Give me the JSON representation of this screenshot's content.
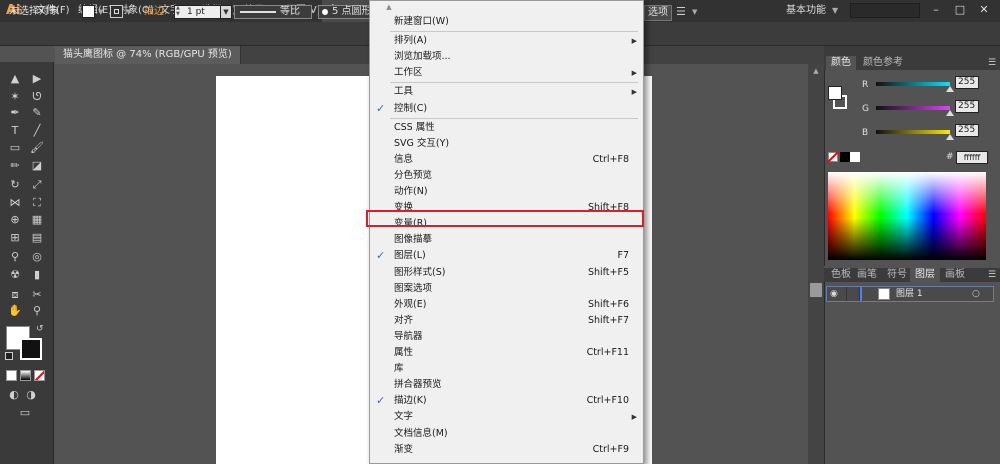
{
  "app": {
    "logo": "Ai"
  },
  "menubar": {
    "items": [
      "文件(F)",
      "编辑(E)",
      "对象(O)",
      "文字(T)",
      "选择(S)",
      "效果(C)",
      "视图(V)",
      "窗口(W)"
    ],
    "workspace": "基本功能",
    "window_controls": [
      "–",
      "□",
      "✕"
    ]
  },
  "controlbar": {
    "selection": "未选择对象",
    "stroke_label": "描边:",
    "stroke_value": "1 pt",
    "profile_label": "等比",
    "brush_label": "5 点圆形",
    "options_label": "选项"
  },
  "document": {
    "tab_title": "猫头鹰图标 @ 74% (RGB/GPU 预览)"
  },
  "color_panel": {
    "tabs": [
      "颜色",
      "颜色参考"
    ],
    "sliders": [
      {
        "label": "R",
        "value": "255",
        "color": "#00e5ff"
      },
      {
        "label": "G",
        "value": "255",
        "color": "#e040fb"
      },
      {
        "label": "B",
        "value": "255",
        "color": "#ffea00"
      }
    ],
    "hex_prefix": "#",
    "hex": "ffffff"
  },
  "layers_panel": {
    "tabs": [
      "色板",
      "画笔",
      "符号",
      "图层",
      "画板"
    ],
    "active_tab": "图层",
    "layers": [
      {
        "name": "图层 1"
      }
    ]
  },
  "window_menu": {
    "items": [
      {
        "label": "新建窗口(W)"
      },
      {
        "sep": true
      },
      {
        "label": "排列(A)",
        "submenu": true
      },
      {
        "label": "浏览加载项..."
      },
      {
        "label": "工作区",
        "submenu": true
      },
      {
        "sep": true
      },
      {
        "label": "工具",
        "submenu": true
      },
      {
        "label": "控制(C)",
        "checked": true
      },
      {
        "sep": true
      },
      {
        "label": "CSS 属性"
      },
      {
        "label": "SVG 交互(Y)"
      },
      {
        "label": "信息",
        "shortcut": "Ctrl+F8"
      },
      {
        "label": "分色预览"
      },
      {
        "label": "动作(N)"
      },
      {
        "label": "变换",
        "shortcut": "Shift+F8",
        "highlighted": true
      },
      {
        "label": "变量(R)"
      },
      {
        "label": "图像描摹"
      },
      {
        "label": "图层(L)",
        "shortcut": "F7",
        "checked": true
      },
      {
        "label": "图形样式(S)",
        "shortcut": "Shift+F5"
      },
      {
        "label": "图案选项"
      },
      {
        "label": "外观(E)",
        "shortcut": "Shift+F6"
      },
      {
        "label": "对齐",
        "shortcut": "Shift+F7"
      },
      {
        "label": "导航器"
      },
      {
        "label": "属性",
        "shortcut": "Ctrl+F11"
      },
      {
        "label": "库"
      },
      {
        "label": "拼合器预览"
      },
      {
        "label": "描边(K)",
        "shortcut": "Ctrl+F10",
        "checked": true
      },
      {
        "label": "文字",
        "submenu": true
      },
      {
        "label": "文档信息(M)"
      },
      {
        "label": "渐变",
        "shortcut": "Ctrl+F9"
      }
    ]
  },
  "toolbar": {
    "tools": [
      [
        "selection-tool",
        "▲"
      ],
      [
        "direct-selection-tool",
        "▶"
      ],
      [
        "magic-wand-tool",
        "✶"
      ],
      [
        "lasso-tool",
        "ᘎ"
      ],
      [
        "pen-tool",
        "✒"
      ],
      [
        "curvature-tool",
        "✎"
      ],
      [
        "type-tool",
        "T"
      ],
      [
        "line-tool",
        "╱"
      ],
      [
        "rectangle-tool",
        "▭"
      ],
      [
        "paintbrush-tool",
        "🖌"
      ],
      [
        "pencil-tool",
        "✏"
      ],
      [
        "eraser-tool",
        "◪"
      ],
      [
        "rotate-tool",
        "↻"
      ],
      [
        "scale-tool",
        "⤢"
      ],
      [
        "width-tool",
        "⋈"
      ],
      [
        "free-transform-tool",
        "⛶"
      ],
      [
        "shape-builder-tool",
        "⊕"
      ],
      [
        "perspective-tool",
        "▦"
      ],
      [
        "mesh-tool",
        "⊞"
      ],
      [
        "gradient-tool",
        "▤"
      ],
      [
        "eyedropper-tool",
        "⚲"
      ],
      [
        "blend-tool",
        "◎"
      ],
      [
        "symbol-sprayer-tool",
        "☢"
      ],
      [
        "column-graph-tool",
        "▮"
      ],
      [
        "artboard-tool",
        "⧈"
      ],
      [
        "slice-tool",
        "✂"
      ],
      [
        "hand-tool",
        "✋"
      ],
      [
        "zoom-tool",
        "⚲"
      ]
    ]
  }
}
